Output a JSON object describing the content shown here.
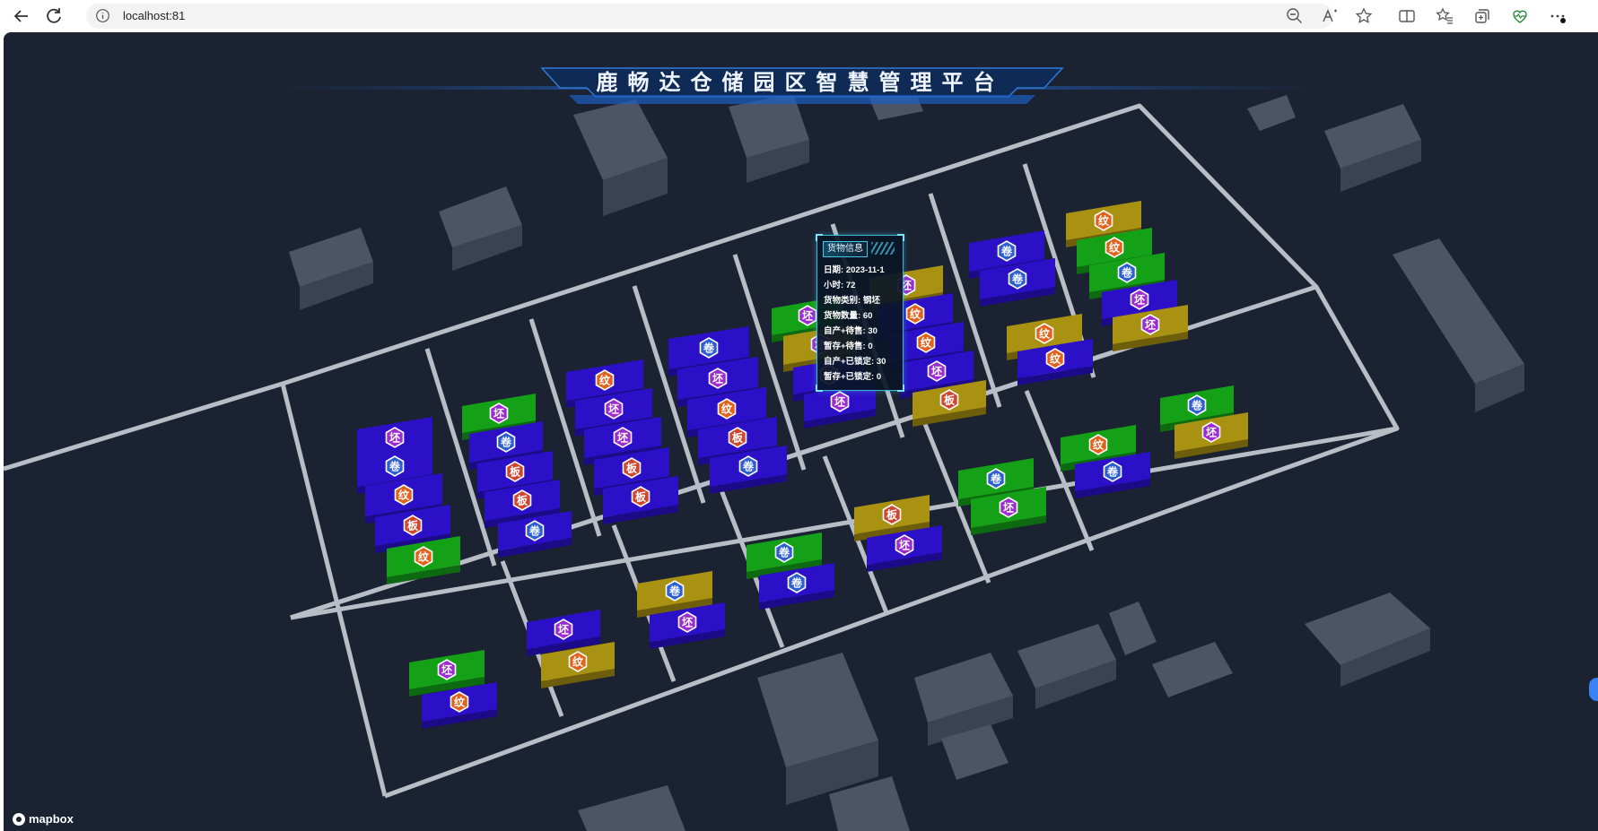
{
  "browser": {
    "url": "localhost:81",
    "icons": [
      "back-icon",
      "refresh-icon",
      "info-icon",
      "zoom-out-icon",
      "read-aloud-icon",
      "favorite-icon",
      "split-screen-icon",
      "favorites-icon",
      "collections-icon",
      "heart-pulse-icon",
      "more-icon"
    ]
  },
  "platform": {
    "title": "鹿畅达仓储园区智慧管理平台",
    "attribution": "mapbox"
  },
  "badges": {
    "coil": "卷",
    "billet": "坯",
    "texture": "纹",
    "plate": "板"
  },
  "colors": {
    "blue": "#2c10c8",
    "green": "#15a117",
    "olive": "#a99112",
    "badge_orange": "#e2621c",
    "badge_purple": "#9c2ccf",
    "badge_blue": "#2d5fd0",
    "badge_red": "#d1462f"
  },
  "tooltip": {
    "title": "货物信息",
    "date_label": "日期:",
    "date_value": "2023-11-1",
    "hours_label": "小时:",
    "hours_value": "72",
    "category_label": "货物类别:",
    "category_value": "钢坯",
    "quantity_label": "货物数量:",
    "quantity_value": "60",
    "self_pending_label": "自产+待售:",
    "self_pending_value": "30",
    "temp_pending_label": "暂存+待售:",
    "temp_pending_value": "0",
    "self_locked_label": "自产+已锁定:",
    "self_locked_value": "30",
    "temp_locked_label": "暂存+已锁定:",
    "temp_locked_value": "0"
  }
}
